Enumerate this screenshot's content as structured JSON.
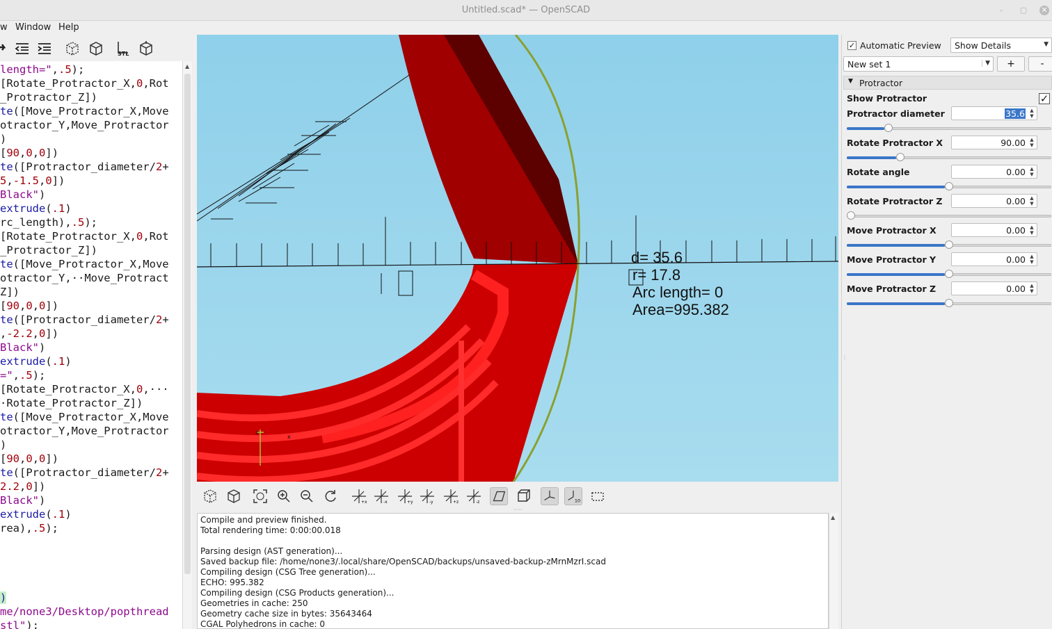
{
  "window": {
    "title": "Untitled.scad* — OpenSCAD",
    "minimize": "–",
    "maximize": "▢",
    "close": "✕"
  },
  "menus": [
    "w",
    "Window",
    "Help"
  ],
  "editor": {
    "lines": [
      [
        [
          "length=\"",
          "s"
        ],
        [
          ",",
          ""
        ],
        [
          ".5",
          "n"
        ],
        [
          ");",
          ""
        ]
      ],
      [
        [
          "[Rotate_Protractor_X,",
          ""
        ],
        [
          "0",
          "n"
        ],
        [
          ",Rot",
          ""
        ]
      ],
      [
        [
          "_Protractor_Z])",
          ""
        ]
      ],
      [
        [
          "te",
          "k"
        ],
        [
          "([Move_Protractor_X,Move",
          ""
        ]
      ],
      [
        [
          "otractor_Y,Move_Protractor",
          ""
        ]
      ],
      [
        [
          ")",
          ""
        ]
      ],
      [
        [
          "[",
          ""
        ],
        [
          "90",
          "n"
        ],
        [
          ",",
          ""
        ],
        [
          "0",
          "n"
        ],
        [
          ",",
          ""
        ],
        [
          "0",
          "n"
        ],
        [
          "])",
          ""
        ]
      ],
      [
        [
          "te",
          "k"
        ],
        [
          "([Protractor_diameter/",
          ""
        ],
        [
          "2",
          "n"
        ],
        [
          "+",
          ""
        ]
      ],
      [
        [
          "5",
          "n"
        ],
        [
          ",",
          ""
        ],
        [
          "-1.5",
          "n"
        ],
        [
          ",",
          ""
        ],
        [
          "0",
          "n"
        ],
        [
          "])",
          ""
        ]
      ],
      [
        [
          "Black\"",
          "s"
        ],
        [
          ")",
          ""
        ]
      ],
      [
        [
          "extrude",
          "k"
        ],
        [
          "(",
          ""
        ],
        [
          ".1",
          "n"
        ],
        [
          ")",
          ""
        ]
      ],
      [
        [
          "rc_length),",
          ""
        ],
        [
          ".5",
          "n"
        ],
        [
          ");",
          ""
        ]
      ],
      [
        [
          "[Rotate_Protractor_X,",
          ""
        ],
        [
          "0",
          "n"
        ],
        [
          ",Rot",
          ""
        ]
      ],
      [
        [
          "_Protractor_Z])",
          ""
        ]
      ],
      [
        [
          "te",
          "k"
        ],
        [
          "([Move_Protractor_X,Move",
          ""
        ]
      ],
      [
        [
          "otractor_Y,··Move_Protract",
          ""
        ]
      ],
      [
        [
          "Z])",
          ""
        ]
      ],
      [
        [
          "[",
          ""
        ],
        [
          "90",
          "n"
        ],
        [
          ",",
          ""
        ],
        [
          "0",
          "n"
        ],
        [
          ",",
          ""
        ],
        [
          "0",
          "n"
        ],
        [
          "])",
          ""
        ]
      ],
      [
        [
          "te",
          "k"
        ],
        [
          "([Protractor_diameter/",
          ""
        ],
        [
          "2",
          "n"
        ],
        [
          "+",
          ""
        ]
      ],
      [
        [
          ",",
          ""
        ],
        [
          "-2.2",
          "n"
        ],
        [
          ",",
          ""
        ],
        [
          "0",
          "n"
        ],
        [
          "])",
          ""
        ]
      ],
      [
        [
          "Black\"",
          "s"
        ],
        [
          ")",
          ""
        ]
      ],
      [
        [
          "extrude",
          "k"
        ],
        [
          "(",
          ""
        ],
        [
          ".1",
          "n"
        ],
        [
          ")",
          ""
        ]
      ],
      [
        [
          "=\"",
          "s"
        ],
        [
          ",",
          ""
        ],
        [
          ".5",
          "n"
        ],
        [
          ");",
          ""
        ]
      ],
      [
        [
          "[Rotate_Protractor_X,",
          ""
        ],
        [
          "0",
          "n"
        ],
        [
          ",···",
          ""
        ]
      ],
      [
        [
          "·Rotate_Protractor_Z])",
          ""
        ]
      ],
      [
        [
          "te",
          "k"
        ],
        [
          "([Move_Protractor_X,Move",
          ""
        ]
      ],
      [
        [
          "otractor_Y,Move_Protractor",
          ""
        ]
      ],
      [
        [
          ")",
          ""
        ]
      ],
      [
        [
          "[",
          ""
        ],
        [
          "90",
          "n"
        ],
        [
          ",",
          ""
        ],
        [
          "0",
          "n"
        ],
        [
          ",",
          ""
        ],
        [
          "0",
          "n"
        ],
        [
          "])",
          ""
        ]
      ],
      [
        [
          "te",
          "k"
        ],
        [
          "([Protractor_diameter/",
          ""
        ],
        [
          "2",
          "n"
        ],
        [
          "+",
          ""
        ]
      ],
      [
        [
          "2.2",
          "n"
        ],
        [
          ",",
          ""
        ],
        [
          "0",
          "n"
        ],
        [
          "])",
          ""
        ]
      ],
      [
        [
          "Black\"",
          "s"
        ],
        [
          ")",
          ""
        ]
      ],
      [
        [
          "extrude",
          "k"
        ],
        [
          "(",
          ""
        ],
        [
          ".1",
          "n"
        ],
        [
          ")",
          ""
        ]
      ],
      [
        [
          "rea),",
          ""
        ],
        [
          ".5",
          "n"
        ],
        [
          ");",
          ""
        ]
      ],
      [
        [
          "",
          ""
        ]
      ],
      [
        [
          "",
          ""
        ]
      ],
      [
        [
          "",
          ""
        ]
      ],
      [
        [
          "",
          ""
        ]
      ],
      [
        [
          ")",
          "k"
        ]
      ],
      [
        [
          "me/none3/Desktop/popthread",
          "s"
        ]
      ],
      [
        [
          "stl\"",
          "s"
        ],
        [
          ");",
          ""
        ]
      ]
    ]
  },
  "viewport": {
    "labels": [
      "d= 35.6",
      "r= 17.8",
      "Arc length= 0",
      "Area=995.382"
    ],
    "colors": {
      "background": "#8fd0ea",
      "model": "#cc0000",
      "model_dark": "#5a0000",
      "ring": "#8aa030"
    }
  },
  "console": {
    "lines": [
      "Compile and preview finished.",
      "Total rendering time: 0:00:00.018",
      "",
      "Parsing design (AST generation)...",
      "Saved backup file: /home/none3/.local/share/OpenSCAD/backups/unsaved-backup-zMrnMzrI.scad",
      "Compiling design (CSG Tree generation)...",
      "ECHO: 995.382",
      "Compiling design (CSG Products generation)...",
      "Geometries in cache: 250",
      "Geometry cache size in bytes: 35643464",
      "CGAL Polyhedrons in cache: 0"
    ]
  },
  "customizer": {
    "auto_preview_label": "Automatic Preview",
    "auto_preview_checked": true,
    "details_mode": "Show Details",
    "preset": "New set 1",
    "add_label": "+",
    "remove_label": "-",
    "group": "Protractor",
    "show_protractor_label": "Show Protractor",
    "show_protractor_checked": true,
    "params": [
      {
        "label": "Protractor diameter",
        "value": "35.6",
        "slider": 0.19
      },
      {
        "label": "Rotate Protractor X",
        "value": "90.00",
        "slider": 0.25
      },
      {
        "label": "Rotate angle",
        "value": "0.00",
        "slider": 0.5
      },
      {
        "label": "Rotate Protractor Z",
        "value": "0.00",
        "slider": 0.0
      },
      {
        "label": "Move Protractor X",
        "value": "0.00",
        "slider": 0.5
      },
      {
        "label": "Move Protractor Y",
        "value": "0.00",
        "slider": 0.5
      },
      {
        "label": "Move Protractor Z",
        "value": "0.00",
        "slider": 0.5
      }
    ]
  }
}
